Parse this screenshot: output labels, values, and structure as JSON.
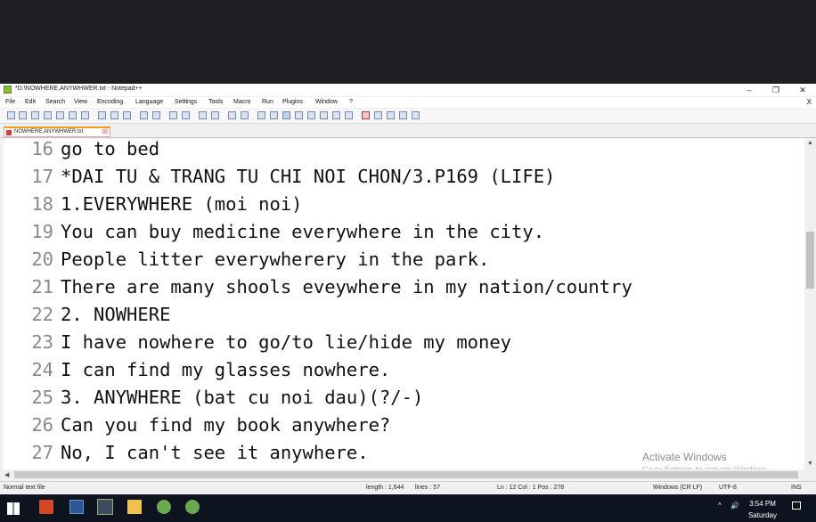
{
  "window": {
    "title": "*D:\\NOWHERE,ANYWHWER.txt - Notepad++",
    "minimize": "–",
    "maximize": "❐",
    "close": "✕"
  },
  "menu": {
    "items": [
      "File",
      "Edit",
      "Search",
      "View",
      "Encoding",
      "Language",
      "Settings",
      "Tools",
      "Macro",
      "Run",
      "Plugins",
      "Window",
      "?"
    ],
    "close_doc": "X"
  },
  "tab": {
    "label": "NOWHERE,ANYWHWER.txt",
    "close": "☒"
  },
  "editor": {
    "lines": [
      {
        "num": "16",
        "text": "go to bed"
      },
      {
        "num": "17",
        "text": "*DAI TU & TRANG TU CHI NOI CHON/3.P169 (LIFE)"
      },
      {
        "num": "18",
        "text": "1.EVERYWHERE (moi noi)"
      },
      {
        "num": "19",
        "text": "You can buy medicine everywhere in the city."
      },
      {
        "num": "20",
        "text": "People litter everywherery in the park."
      },
      {
        "num": "21",
        "text": "There are many shools eveywhere in my nation/country"
      },
      {
        "num": "22",
        "text": "2. NOWHERE"
      },
      {
        "num": "23",
        "text": "I have nowhere to go/to lie/hide my money"
      },
      {
        "num": "24",
        "text": "I can find my glasses nowhere."
      },
      {
        "num": "25",
        "text": "3. ANYWHERE (bat cu noi dau)(?/-)"
      },
      {
        "num": "26",
        "text": "Can you find my book anywhere?"
      },
      {
        "num": "27",
        "text": "No, I can't see it anywhere."
      }
    ]
  },
  "status": {
    "type": "Normal text file",
    "length": "length : 1,644",
    "lines": "lines : 57",
    "position": "Ln : 12   Col : 1   Pos : 278",
    "eol": "Windows (CR LF)",
    "encoding": "UTF-8",
    "mode": "INS"
  },
  "watermark": {
    "title": "Activate Windows",
    "subtitle": "Go to Settings to activate Windows."
  },
  "taskbar": {
    "time": "3:54 PM",
    "day": "Saturday"
  },
  "colors": {
    "accent_tab": "#f0a020",
    "taskbar": "#0e1320",
    "editor_bg": "#ffffff"
  }
}
